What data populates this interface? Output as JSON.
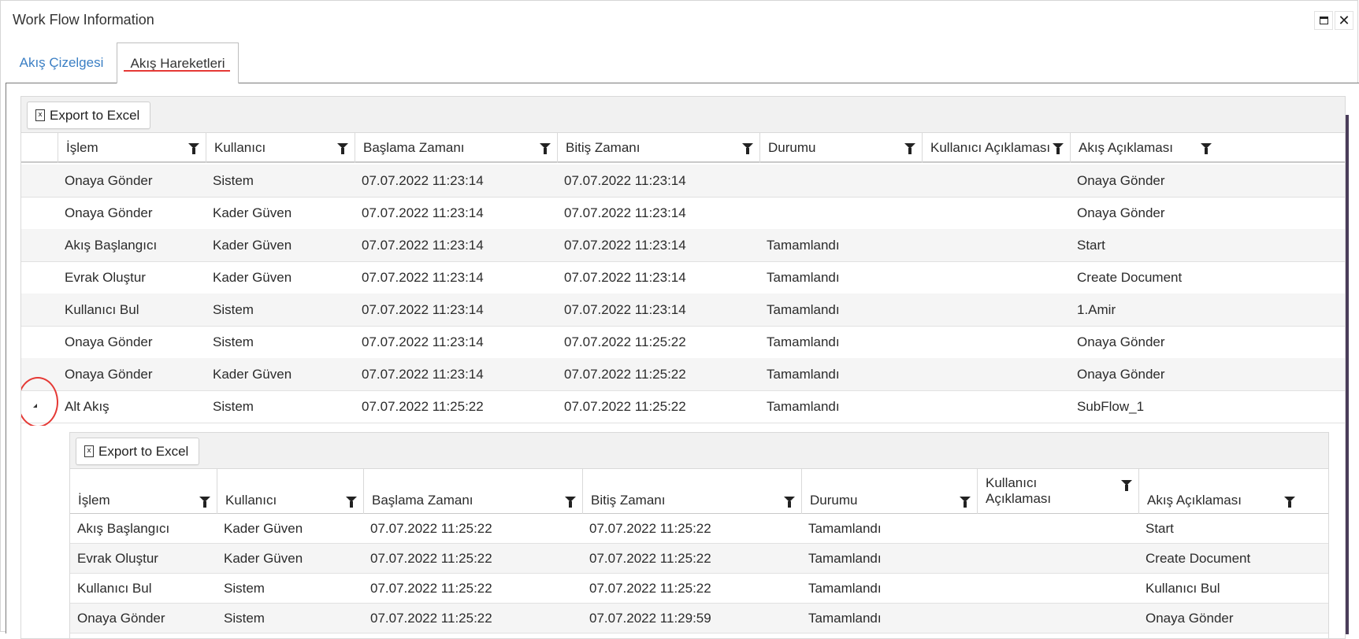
{
  "window": {
    "title": "Work Flow Information"
  },
  "tabs": [
    {
      "label": "Akış Çizelgesi"
    },
    {
      "label": "Akış Hareketleri"
    }
  ],
  "grid": {
    "export_label": "Export to Excel",
    "columns": [
      "İşlem",
      "Kullanıcı",
      "Başlama Zamanı",
      "Bitiş Zamanı",
      "Durumu",
      "Kullanıcı Açıklaması",
      "Akış Açıklaması"
    ],
    "rows": [
      [
        "Onaya Gönder",
        "Sistem",
        "07.07.2022 11:23:14",
        "07.07.2022 11:23:14",
        "",
        "",
        "Onaya Gönder"
      ],
      [
        "Onaya Gönder",
        "Kader Güven",
        "07.07.2022 11:23:14",
        "07.07.2022 11:23:14",
        "",
        "",
        "Onaya Gönder"
      ],
      [
        "Akış Başlangıcı",
        "Kader Güven",
        "07.07.2022 11:23:14",
        "07.07.2022 11:23:14",
        "Tamamlandı",
        "",
        "Start"
      ],
      [
        "Evrak Oluştur",
        "Kader Güven",
        "07.07.2022 11:23:14",
        "07.07.2022 11:23:14",
        "Tamamlandı",
        "",
        "Create Document"
      ],
      [
        "Kullanıcı Bul",
        "Sistem",
        "07.07.2022 11:23:14",
        "07.07.2022 11:23:14",
        "Tamamlandı",
        "",
        "1.Amir"
      ],
      [
        "Onaya Gönder",
        "Sistem",
        "07.07.2022 11:23:14",
        "07.07.2022 11:25:22",
        "Tamamlandı",
        "",
        "Onaya Gönder"
      ],
      [
        "Onaya Gönder",
        "Kader Güven",
        "07.07.2022 11:23:14",
        "07.07.2022 11:25:22",
        "Tamamlandı",
        "",
        "Onaya Gönder"
      ],
      [
        "Alt Akış",
        "Sistem",
        "07.07.2022 11:25:22",
        "07.07.2022 11:25:22",
        "Tamamlandı",
        "",
        "SubFlow_1"
      ]
    ]
  },
  "nested_grid": {
    "export_label": "Export to Excel",
    "columns": [
      "İşlem",
      "Kullanıcı",
      "Başlama Zamanı",
      "Bitiş Zamanı",
      "Durumu",
      "Kullanıcı Açıklaması",
      "Akış Açıklaması"
    ],
    "column_lines": {
      "user_desc_1": "Kullanıcı",
      "user_desc_2": "Açıklaması"
    },
    "rows": [
      [
        "Akış Başlangıcı",
        "Kader Güven",
        "07.07.2022 11:25:22",
        "07.07.2022 11:25:22",
        "Tamamlandı",
        "",
        "Start"
      ],
      [
        "Evrak Oluştur",
        "Kader Güven",
        "07.07.2022 11:25:22",
        "07.07.2022 11:25:22",
        "Tamamlandı",
        "",
        "Create Document"
      ],
      [
        "Kullanıcı Bul",
        "Sistem",
        "07.07.2022 11:25:22",
        "07.07.2022 11:25:22",
        "Tamamlandı",
        "",
        "Kullanıcı Bul"
      ],
      [
        "Onaya Gönder",
        "Sistem",
        "07.07.2022 11:25:22",
        "07.07.2022 11:29:59",
        "Tamamlandı",
        "",
        "Onaya Gönder"
      ]
    ]
  }
}
